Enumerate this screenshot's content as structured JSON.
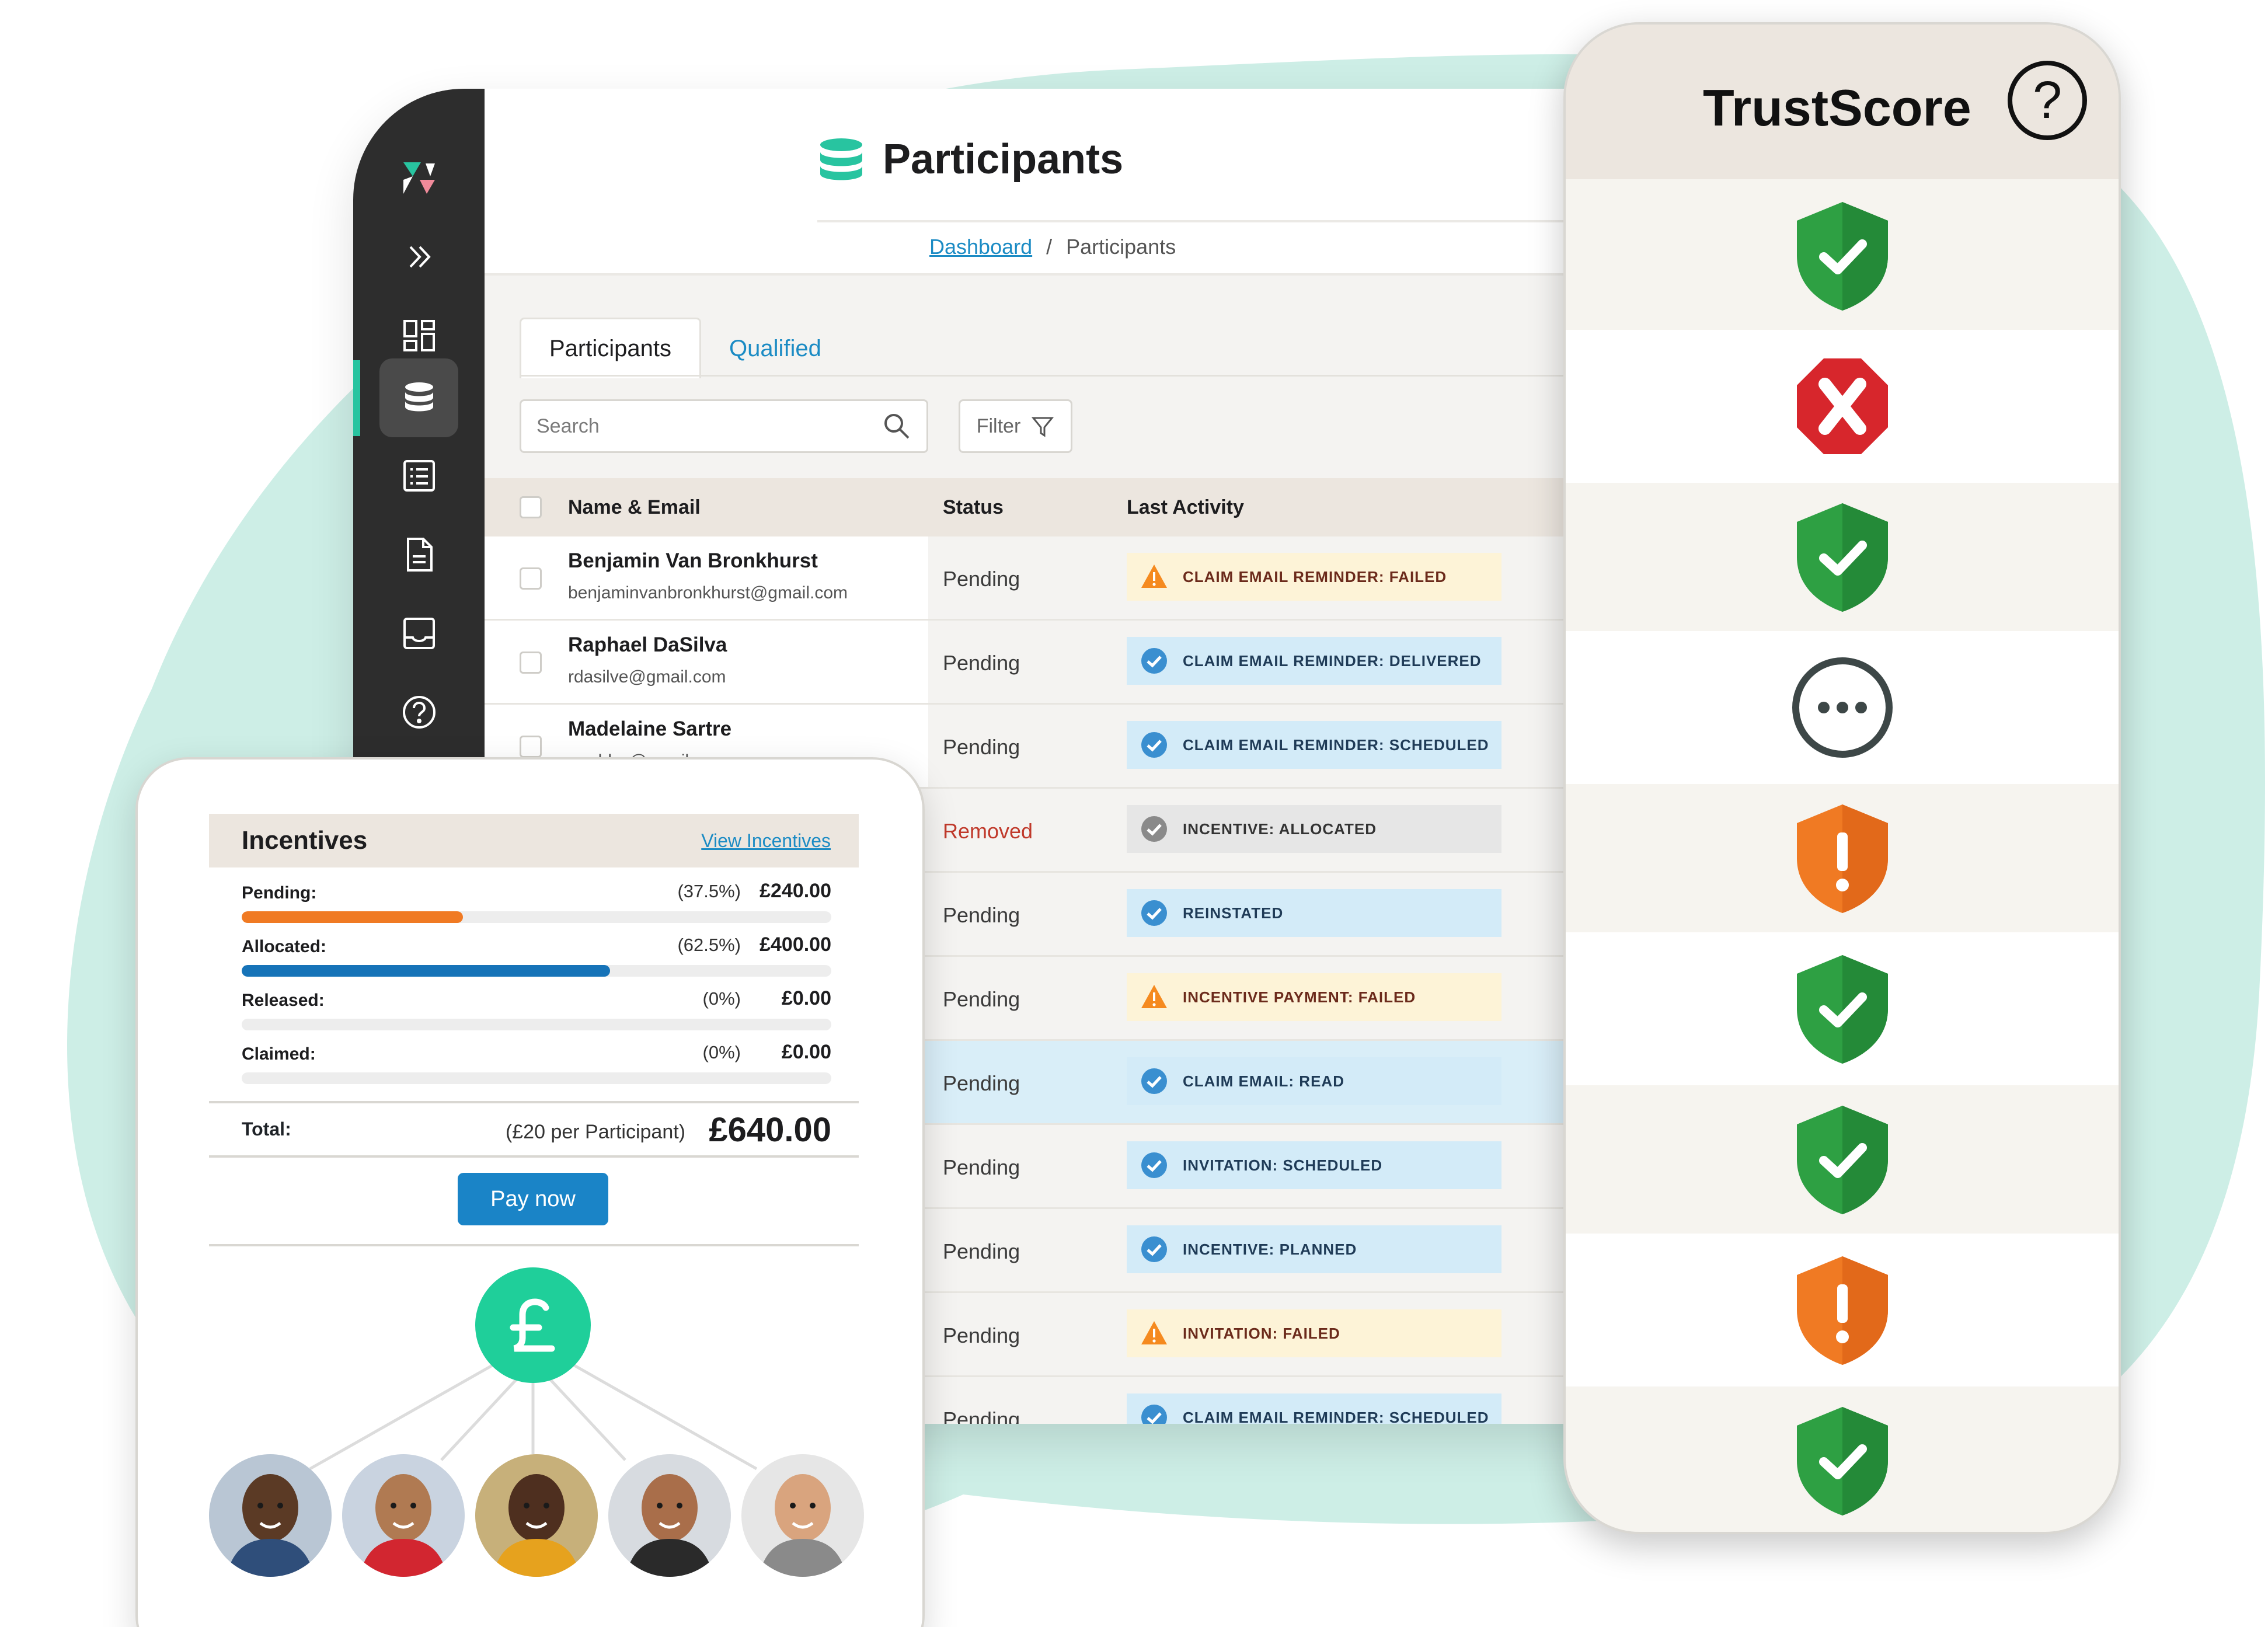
{
  "app": {
    "title": "Participants",
    "breadcrumb": {
      "dashboard": "Dashboard",
      "separator": "/",
      "current": "Participants"
    },
    "sidebar_icons": [
      "logo-icon",
      "expand-icon",
      "dashboard-icon",
      "database-icon",
      "list-icon",
      "document-icon",
      "inbox-icon",
      "help-icon"
    ],
    "tabs": [
      {
        "label": "Participants",
        "active": true
      },
      {
        "label": "Qualified",
        "active": false
      }
    ],
    "search": {
      "placeholder": "Search"
    },
    "filter": {
      "label": "Filter"
    },
    "table": {
      "headers": {
        "name": "Name & Email",
        "status": "Status",
        "activity": "Last Activity"
      },
      "rows": [
        {
          "name": "Benjamin Van Bronkhurst",
          "email": "benjaminvanbronkhurst@gmail.com",
          "status": "Pending",
          "activity": "CLAIM EMAIL REMINDER: FAILED",
          "kind": "warn"
        },
        {
          "name": "Raphael DaSilva",
          "email": "rdasilve@gmail.com",
          "status": "Pending",
          "activity": "CLAIM EMAIL REMINDER: DELIVERED",
          "kind": "info"
        },
        {
          "name": "Madelaine Sartre",
          "email": "maddys@gmail.com",
          "status": "Pending",
          "activity": "CLAIM EMAIL REMINDER: SCHEDULED",
          "kind": "info"
        },
        {
          "name": "",
          "email": "",
          "status": "Removed",
          "activity": "INCENTIVE: ALLOCATED",
          "kind": "neutral"
        },
        {
          "name": "",
          "email": "",
          "status": "Pending",
          "activity": "REINSTATED",
          "kind": "info"
        },
        {
          "name": "",
          "email": "",
          "status": "Pending",
          "activity": "INCENTIVE PAYMENT: FAILED",
          "kind": "warn"
        },
        {
          "name": "",
          "email": "",
          "status": "Pending",
          "activity": "CLAIM EMAIL: READ",
          "kind": "info"
        },
        {
          "name": "",
          "email": "",
          "status": "Pending",
          "activity": "INVITATION: SCHEDULED",
          "kind": "info"
        },
        {
          "name": "",
          "email": "",
          "status": "Pending",
          "activity": "INCENTIVE: PLANNED",
          "kind": "info"
        },
        {
          "name": "",
          "email": "",
          "status": "Pending",
          "activity": "INVITATION: FAILED",
          "kind": "warn"
        },
        {
          "name": "",
          "email": "",
          "status": "Pending",
          "activity": "CLAIM EMAIL REMINDER: SCHEDULED",
          "kind": "info"
        }
      ]
    }
  },
  "trustscore": {
    "title": "TrustScore",
    "help": "?",
    "items": [
      "shield-check",
      "stop-x",
      "shield-check",
      "pending-dots",
      "shield-alert",
      "shield-check",
      "shield-check",
      "shield-alert",
      "shield-check"
    ]
  },
  "incentives": {
    "title": "Incentives",
    "link": "View Incentives",
    "rows": [
      {
        "label": "Pending:",
        "percent": "(37.5%)",
        "amount": "£240.00",
        "fill": 0.375,
        "color": "#f07a23"
      },
      {
        "label": "Allocated:",
        "percent": "(62.5%)",
        "amount": "£400.00",
        "fill": 0.625,
        "color": "#1673b8"
      },
      {
        "label": "Released:",
        "percent": "(0%)",
        "amount": "£0.00",
        "fill": 0,
        "color": "#1673b8"
      },
      {
        "label": "Claimed:",
        "percent": "(0%)",
        "amount": "£0.00",
        "fill": 0,
        "color": "#1673b8"
      }
    ],
    "total": {
      "label": "Total:",
      "note": "(£20 per Participant)",
      "amount": "£640.00"
    },
    "pay_button": "Pay now",
    "participants_count": 5
  },
  "colors": {
    "accent": "#28c4a0",
    "link": "#1b8bc4",
    "blob": "#cdeee6",
    "sidebar": "#2d2d2d",
    "check": "#2ea043",
    "alert": "#f07a23",
    "stop": "#d7262c"
  }
}
